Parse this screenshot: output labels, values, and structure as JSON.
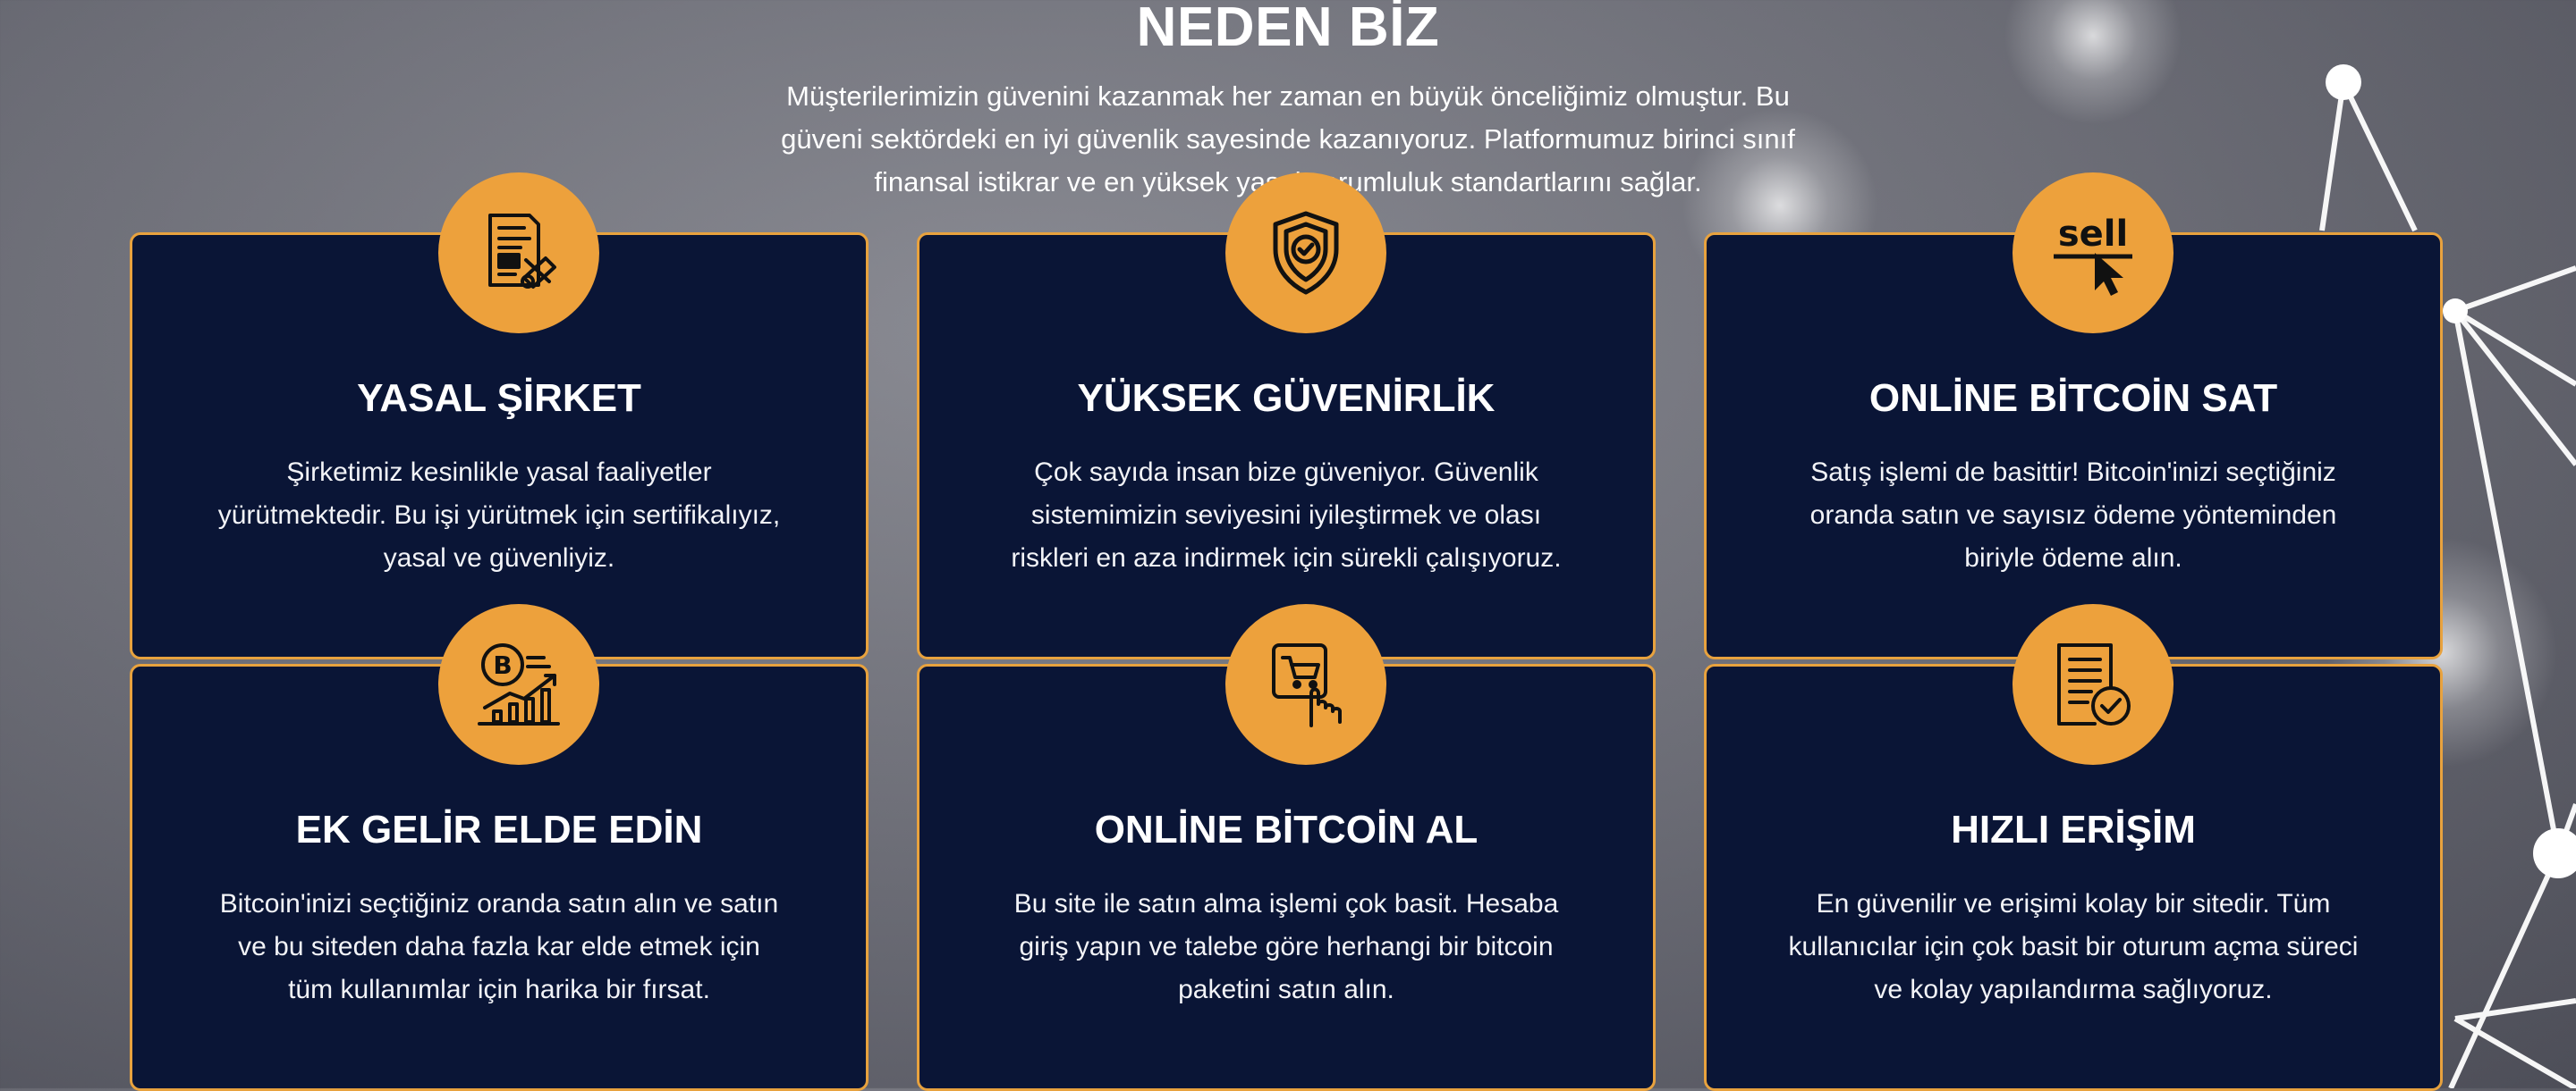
{
  "section": {
    "title": "NEDEN BİZ",
    "subtitle": "Müşterilerimizin güvenini kazanmak her zaman en büyük önceliğimiz olmuştur. Bu güveni sektördeki en iyi güvenlik sayesinde kazanıyoruz. Platformumuz birinci sınıf finansal istikrar ve en yüksek yasal sorumluluk standartlarını sağlar."
  },
  "colors": {
    "accent": "#eda13c",
    "card_bg": "#0a1536",
    "card_border": "#e8a23e"
  },
  "cards": [
    {
      "icon": "legal-document-icon",
      "title": "YASAL ŞİRKET",
      "text": "Şirketimiz kesinlikle yasal faaliyetler yürütmektedir. Bu işi yürütmek için sertifikalıyız, yasal ve güvenliyiz."
    },
    {
      "icon": "shield-check-icon",
      "title": "YÜKSEK GÜVENİRLİK",
      "text": "Çok sayıda insan bize güveniyor. Güvenlik sistemimizin seviyesini iyileştirmek ve olası riskleri en aza indirmek için sürekli çalışıyoruz."
    },
    {
      "icon": "sell-cursor-icon",
      "title": "ONLİNE BİTCOİN SAT",
      "text": "Satış işlemi de basittir! Bitcoin'inizi seçtiğiniz oranda satın ve sayısız ödeme yönteminden biriyle ödeme alın."
    },
    {
      "icon": "bitcoin-growth-chart-icon",
      "title": "EK GELİR ELDE EDİN",
      "text": "Bitcoin'inizi seçtiğiniz oranda satın alın ve satın ve bu siteden daha fazla kar elde etmek için tüm kullanımlar için harika bir fırsat."
    },
    {
      "icon": "shopping-cart-touch-icon",
      "title": "ONLİNE BİTCOİN AL",
      "text": "Bu site ile satın alma işlemi çok basit. Hesaba giriş yapın ve talebe göre herhangi bir bitcoin paketini satın alın."
    },
    {
      "icon": "checklist-icon",
      "title": "HIZLI ERİŞİM",
      "text": "En güvenilir ve erişimi kolay bir sitedir. Tüm kullanıcılar için çok basit bir oturum açma süreci ve kolay yapılandırma sağlıyoruz."
    }
  ]
}
